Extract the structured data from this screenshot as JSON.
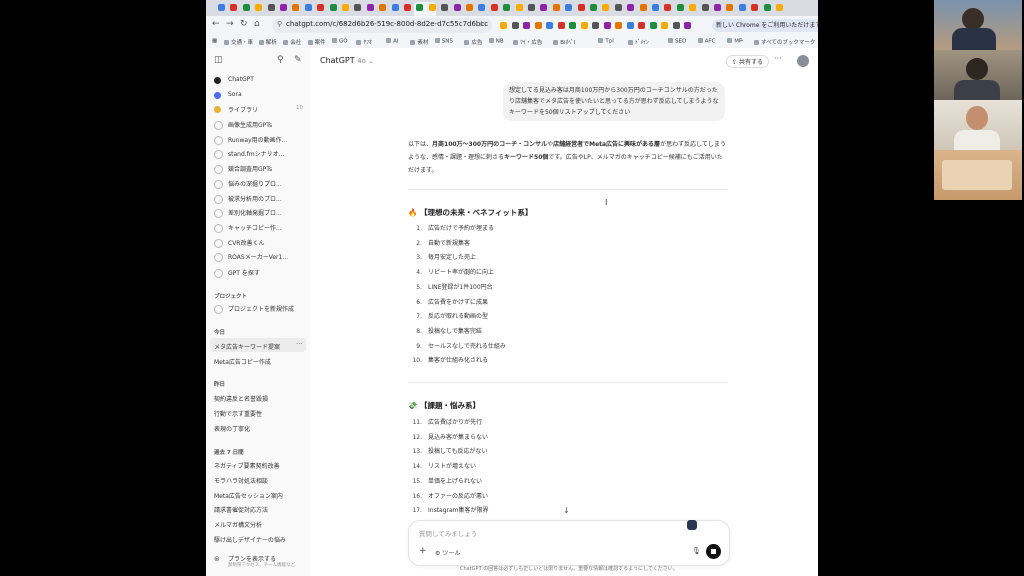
{
  "browser": {
    "url": "chatgpt.com/c/682d6b26-519c-800d-8d2e-d7c55c7d6bcc",
    "relaunch_label": "新しい Chrome をご利用いただけます",
    "bookmarks": [
      "交通・車",
      "解析",
      "会社",
      "案件",
      "GO",
      "ﾔﾌｵ",
      "AI",
      "素材",
      "SNS",
      "広告",
      "NB",
      "ﾂｲ・広告",
      "BiｵﾍﾟI",
      "Tpl",
      "ﾄﾞﾒｲﾝ",
      "SEO",
      "AFC",
      "MF"
    ],
    "all_bookmarks": "すべてのブックマーク"
  },
  "sidebar": {
    "top_items": [
      {
        "icon": "chatgpt-icon",
        "label": "ChatGPT"
      },
      {
        "icon": "sora-icon",
        "label": "Sora"
      },
      {
        "icon": "library-icon",
        "label": "ライブラリ",
        "count": "10"
      }
    ],
    "gpts": [
      "画像生成用GPTs",
      "Runway用の動画作...",
      "stand.fmシナリオ...",
      "競合調査用GPTs",
      "悩みの深掘りプロ...",
      "被求分析用のプロ...",
      "差別化軸発掘プロ...",
      "キャッチコピー作...",
      "CVR改善くん",
      "ROASメーカーVer1..."
    ],
    "explore": "GPT を探す",
    "project_head": "プロジェクト",
    "new_project": "プロジェクトを新規作成",
    "today_head": "今日",
    "today": [
      "メタ広告キーワード提案",
      "Meta広告コピー作成"
    ],
    "yesterday_head": "昨日",
    "yesterday": [
      "契約違反と名誉毀損",
      "行動で示す重要性",
      "表現の丁寧化"
    ],
    "week_head": "過去 7 日間",
    "week": [
      "ネガティブ要素契約改善",
      "モラハラ対処法相談",
      "Meta広告セッション案内",
      "請求書催促対応方法",
      "メルマガ構文分析",
      "駆け出しデザイナーの悩み"
    ],
    "upgrade_title": "プランを表示する",
    "upgrade_sub": "無制限アクセス、チーム機能など"
  },
  "main": {
    "model": "ChatGPT",
    "model_version": "4o",
    "share_label": "共有する",
    "user_message": "想定してる見込み客は月商100万円から300万円のコーチコンサルの方だったり店舗集客でメタ広告を使いたいと思ってる方が思わず反応してしまうようなキーワードを50個リストアップしてください",
    "answer_intro": {
      "p1": "以下は、",
      "b1": "月商100万〜300万円のコーチ・コンサル",
      "p2": "や",
      "b2": "店舗経営者でMeta広告に興味がある層",
      "p3": "が思わず反応してしまうような、感情・課題・理想に刺さる",
      "b3": "キーワード50個",
      "p4": "です。広告やLP、メルマガのキャッチコピー候補にもご活用いただけます。"
    },
    "section1": {
      "emoji": "🔥",
      "title": "【理想の未来・ベネフィット系】"
    },
    "list1": [
      {
        "n": "1.",
        "t": "広告だけで予約が埋まる"
      },
      {
        "n": "2.",
        "t": "自動で新規集客"
      },
      {
        "n": "3.",
        "t": "毎月安定した売上"
      },
      {
        "n": "4.",
        "t": "リピート率が劇的に向上"
      },
      {
        "n": "5.",
        "t": "LINE登録が1件100円台"
      },
      {
        "n": "6.",
        "t": "広告費をかけずに成果"
      },
      {
        "n": "7.",
        "t": "反応が取れる動画の型"
      },
      {
        "n": "8.",
        "t": "投稿なしで集客完結"
      },
      {
        "n": "9.",
        "t": "セールスなしで売れる仕組み"
      },
      {
        "n": "10.",
        "t": "集客が仕組み化される"
      }
    ],
    "section2": {
      "emoji": "💸",
      "title": "【課題・悩み系】"
    },
    "list2": [
      {
        "n": "11.",
        "t": "広告費ばかりが先行"
      },
      {
        "n": "12.",
        "t": "見込み客が集まらない"
      },
      {
        "n": "13.",
        "t": "投稿しても反応がない"
      },
      {
        "n": "14.",
        "t": "リストが増えない"
      },
      {
        "n": "15.",
        "t": "単価を上げられない"
      },
      {
        "n": "16.",
        "t": "オファーの反応が悪い"
      },
      {
        "n": "17.",
        "t": "Instagram集客が限界"
      }
    ],
    "composer_placeholder": "質問してみましょう",
    "tools_label": "ツール",
    "footer": "ChatGPT の回答は必ずしも正しいとは限りません。重要な情報は確認するようにしてください。"
  },
  "colors": {
    "sidebar_bg": "#f9f9f9",
    "bubble_bg": "#f2f2f2",
    "chrome_bg": "#f3f5f8"
  }
}
